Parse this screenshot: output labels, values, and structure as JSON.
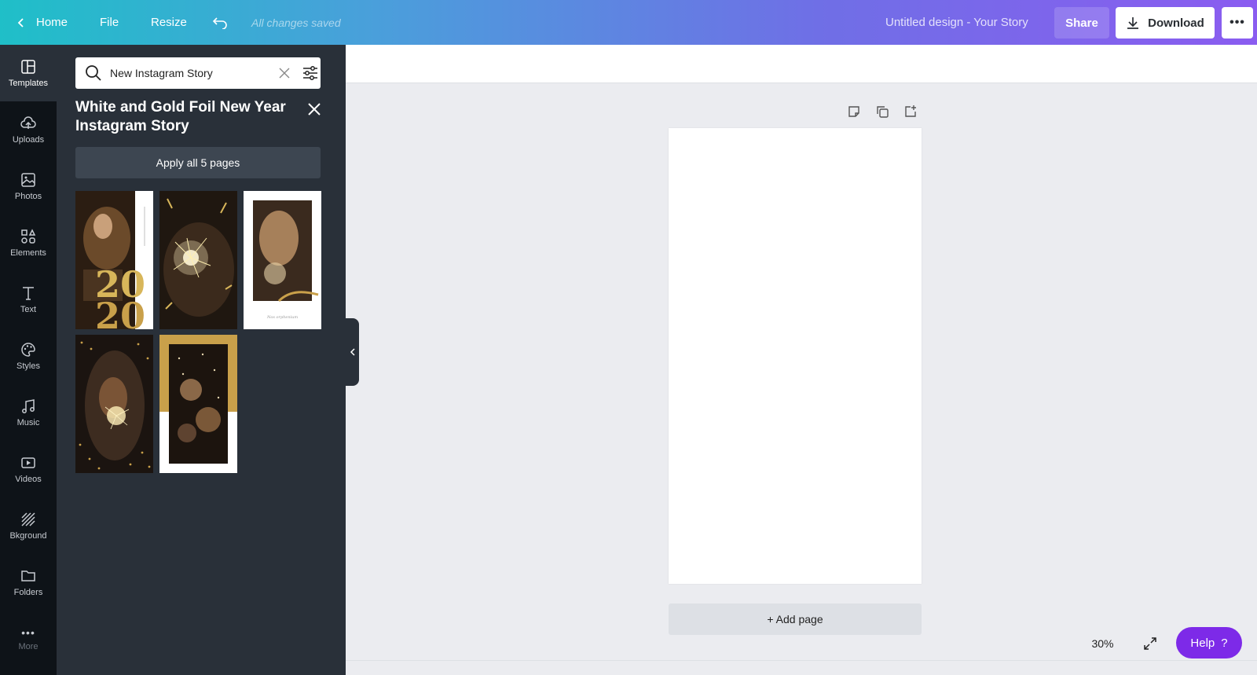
{
  "topbar": {
    "home": "Home",
    "file": "File",
    "resize": "Resize",
    "saved_status": "All changes saved",
    "doc_title": "Untitled design - Your Story",
    "share": "Share",
    "download": "Download"
  },
  "rail": {
    "items": [
      {
        "label": "Templates",
        "icon": "templates-icon"
      },
      {
        "label": "Uploads",
        "icon": "upload-cloud-icon"
      },
      {
        "label": "Photos",
        "icon": "photo-icon"
      },
      {
        "label": "Elements",
        "icon": "shapes-icon"
      },
      {
        "label": "Text",
        "icon": "text-icon"
      },
      {
        "label": "Styles",
        "icon": "palette-icon"
      },
      {
        "label": "Music",
        "icon": "music-note-icon"
      },
      {
        "label": "Videos",
        "icon": "video-icon"
      },
      {
        "label": "Bkground",
        "icon": "background-stripes-icon"
      },
      {
        "label": "Folders",
        "icon": "folder-icon"
      },
      {
        "label": "More",
        "icon": "more-dots-icon"
      }
    ]
  },
  "panel": {
    "search_value": "New Instagram Story",
    "title": "White and Gold Foil New Year Instagram Story",
    "apply_label": "Apply all 5 pages",
    "thumbnails": [
      "2020 gold champagne",
      "sparklers",
      "champagne toast",
      "sparkler portrait",
      "confetti party"
    ]
  },
  "canvas": {
    "add_page": "+ Add page",
    "zoom": "30%",
    "help": "Help",
    "help_glyph": "?"
  },
  "colors": {
    "accent_purple": "#7d2ae8",
    "panel_bg": "#293039",
    "rail_bg": "#0e1318"
  }
}
